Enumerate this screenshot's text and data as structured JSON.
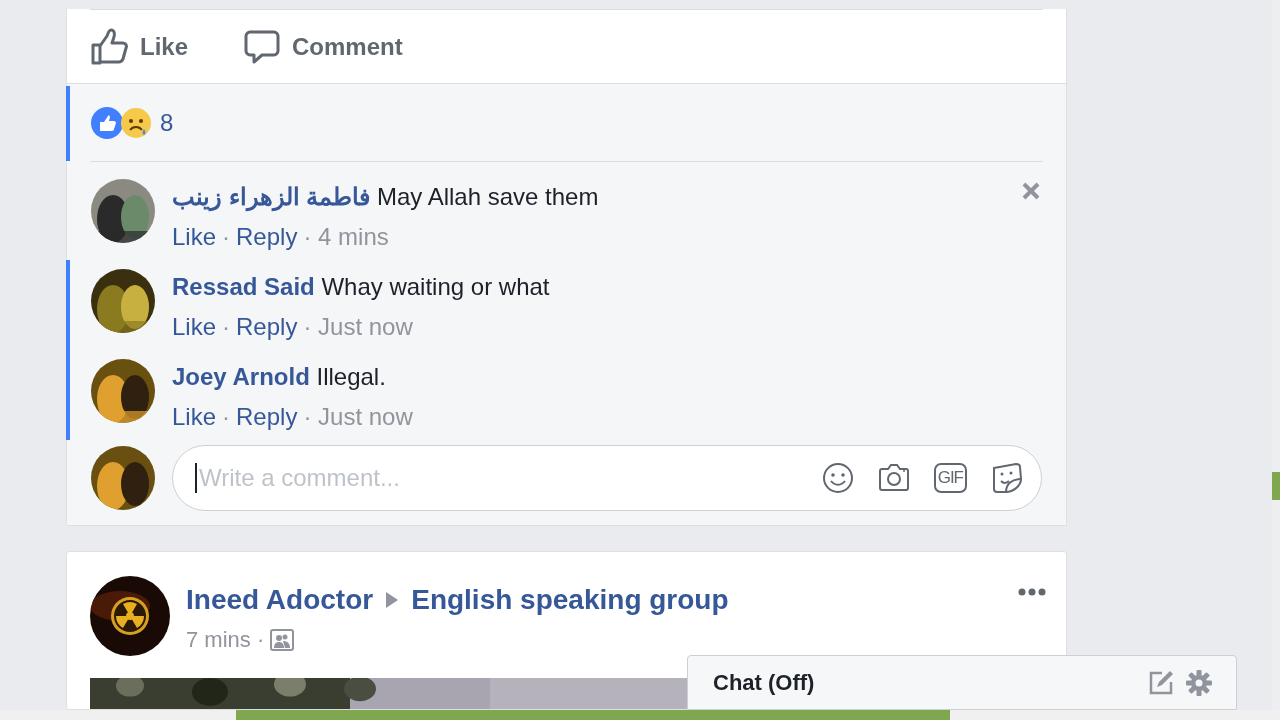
{
  "actions": [
    {
      "kind": "like",
      "label": "Like"
    },
    {
      "kind": "comment",
      "label": "Comment"
    }
  ],
  "reactions": {
    "count": "8"
  },
  "comments": [
    {
      "author": "فاطمة الزهراء زينب",
      "text": "May Allah save them",
      "like": "Like",
      "reply": "Reply",
      "sep": "·",
      "time": "· 4 mins",
      "new": false,
      "hovered": true
    },
    {
      "author": "Ressad Said",
      "text": "Whay waiting or what",
      "like": "Like",
      "reply": "Reply",
      "sep": "·",
      "time": "· Just now",
      "new": true,
      "hovered": false
    },
    {
      "author": "Joey Arnold",
      "text": "Illegal.",
      "like": "Like",
      "reply": "Reply",
      "sep": "·",
      "time": "· Just now",
      "new": true,
      "hovered": false
    }
  ],
  "composer": {
    "placeholder": "Write a comment...",
    "gif": "GIF"
  },
  "post": {
    "author": "Ineed Adoctor",
    "group": "English speaking group",
    "time": "7 mins ·"
  },
  "chat": {
    "label": "Chat (Off)"
  }
}
